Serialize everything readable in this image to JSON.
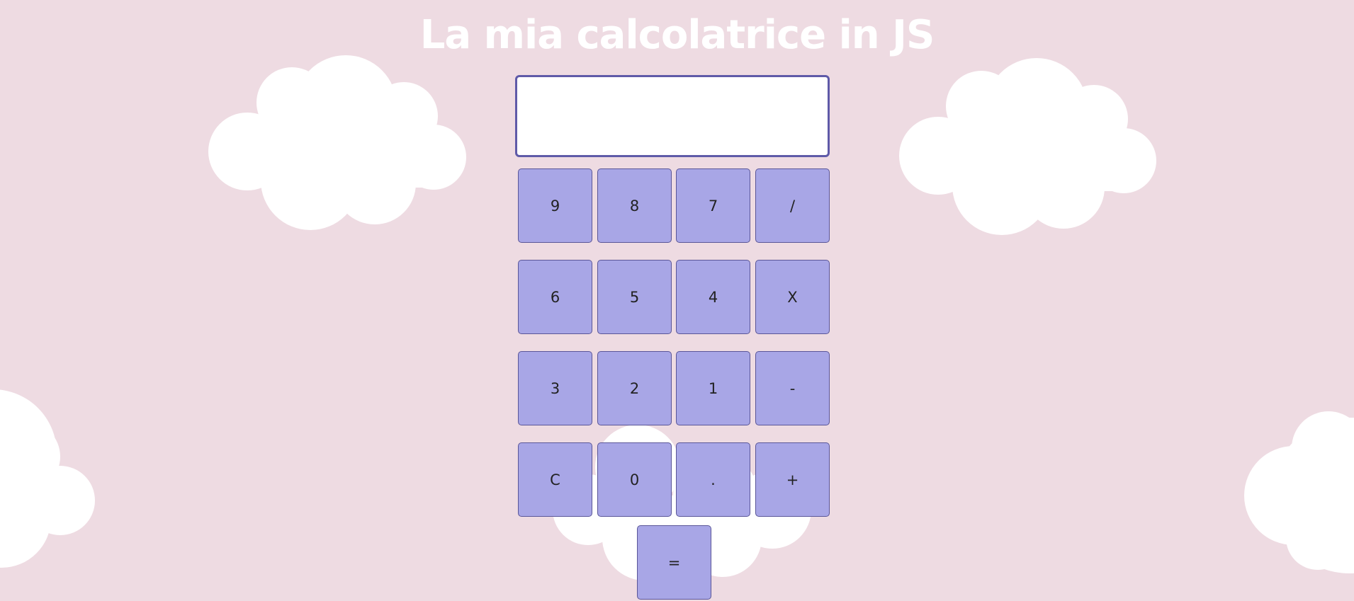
{
  "title": "La mia calcolatrice in JS",
  "display": {
    "value": ""
  },
  "keys": {
    "nine": "9",
    "eight": "8",
    "seven": "7",
    "divide": "/",
    "six": "6",
    "five": "5",
    "four": "4",
    "multiply": "X",
    "three": "3",
    "two": "2",
    "one": "1",
    "subtract": "-",
    "clear": "C",
    "zero": "0",
    "decimal": ".",
    "add": "+",
    "equals": "="
  },
  "colors": {
    "background": "#eedbe2",
    "cloud": "#ffffff",
    "key": "#a8a6e6",
    "key_border": "#5a5698",
    "display_border": "#5f5aa8",
    "title": "#ffffff"
  }
}
